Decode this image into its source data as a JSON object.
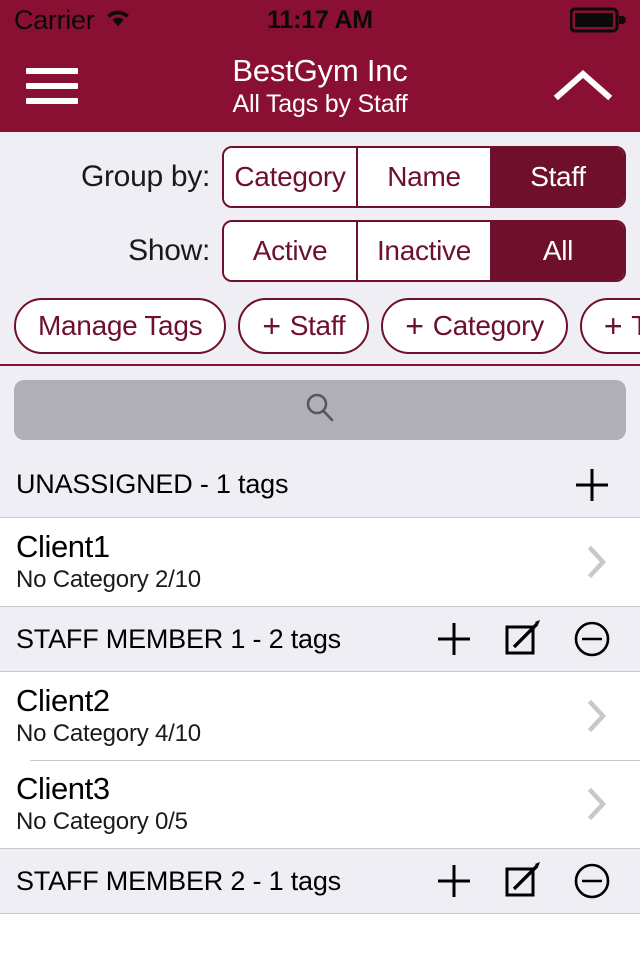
{
  "theme": {
    "brand_maroon": "#8A1033",
    "control_maroon": "#6E0F2C",
    "group_bg": "#EFEEF4",
    "search_fill": "#B0AFB8",
    "separator": "#C8C7CC",
    "chevron_gray": "#C7C7CC"
  },
  "status_bar": {
    "carrier": "Carrier",
    "wifi_icon": "wifi-icon",
    "time": "11:17 AM",
    "battery_icon": "battery-full-icon"
  },
  "nav_bar": {
    "menu_icon": "hamburger-menu-icon",
    "title": "BestGym Inc",
    "subtitle": "All Tags by Staff",
    "collapse_icon": "chevron-up-icon"
  },
  "toolbar": {
    "group_by": {
      "label": "Group by:",
      "options": [
        "Category",
        "Name",
        "Staff"
      ],
      "selected": "Staff"
    },
    "show": {
      "label": "Show:",
      "options": [
        "Active",
        "Inactive",
        "All"
      ],
      "selected": "All"
    },
    "pills": [
      {
        "label": "Manage Tags",
        "has_plus": false
      },
      {
        "label": "Staff",
        "has_plus": true,
        "plus": "+"
      },
      {
        "label": "Category",
        "has_plus": true,
        "plus": "+"
      },
      {
        "label": "Tag",
        "has_plus": true,
        "plus": "+"
      }
    ]
  },
  "search": {
    "value": "",
    "placeholder": "",
    "icon": "search-icon"
  },
  "list": {
    "sections": [
      {
        "title": "UNASSIGNED - 1 tags",
        "actions": [
          "add-icon"
        ],
        "rows": [
          {
            "title": "Client1",
            "subtitle": "No Category 2/10",
            "chevron": "chevron-right-icon"
          }
        ]
      },
      {
        "title": "STAFF MEMBER 1 - 2 tags",
        "actions": [
          "add-icon",
          "edit-icon",
          "remove-icon"
        ],
        "rows": [
          {
            "title": "Client2",
            "subtitle": "No Category 4/10",
            "chevron": "chevron-right-icon"
          },
          {
            "title": "Client3",
            "subtitle": "No Category 0/5",
            "chevron": "chevron-right-icon"
          }
        ]
      },
      {
        "title": "STAFF MEMBER 2 - 1 tags",
        "actions": [
          "add-icon",
          "edit-icon",
          "remove-icon"
        ],
        "rows": []
      }
    ]
  }
}
